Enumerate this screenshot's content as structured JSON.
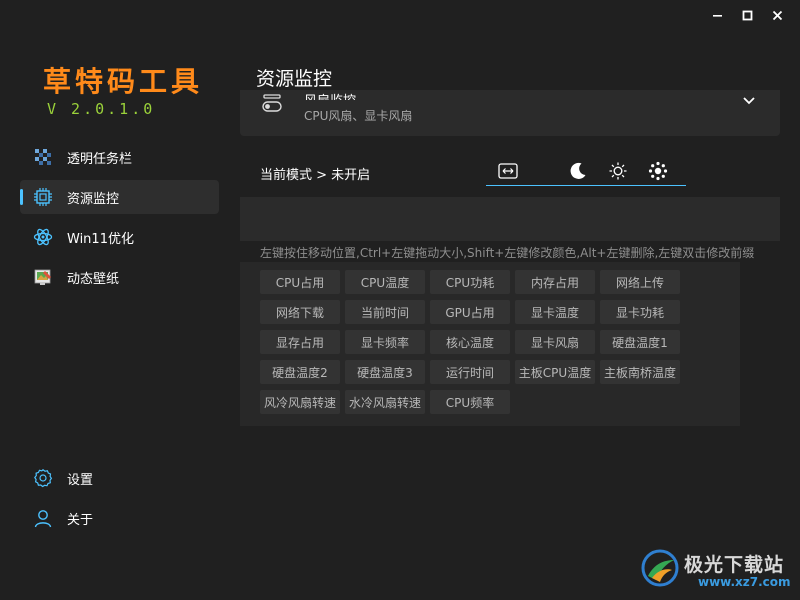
{
  "window": {
    "minimize": "—",
    "maximize": "□",
    "close": "×"
  },
  "app": {
    "title": "草特码工具",
    "version": "V 2.0.1.0"
  },
  "sidebar": {
    "items": [
      {
        "label": "透明任务栏",
        "icon": "checker-icon"
      },
      {
        "label": "资源监控",
        "icon": "cpu-chip-icon",
        "active": true
      },
      {
        "label": "Win11优化",
        "icon": "atom-icon"
      },
      {
        "label": "动态壁纸",
        "icon": "wallpaper-icon"
      }
    ],
    "bottom": [
      {
        "label": "设置",
        "icon": "gear-icon"
      },
      {
        "label": "关于",
        "icon": "user-icon"
      }
    ]
  },
  "main": {
    "title": "资源监控",
    "card": {
      "title_partial": "风扇监控",
      "subtitle": "CPU风扇、显卡风扇"
    },
    "mode": "当前模式 > 未开启",
    "toolbar": [
      "resize-horizontal-icon",
      "moon-icon",
      "sun-icon",
      "brightness-dots-icon"
    ],
    "hint": "左键按住移动位置,Ctrl+左键拖动大小,Shift+左键修改颜色,Alt+左键删除,左键双击修改前缀",
    "chips": [
      "CPU占用",
      "CPU温度",
      "CPU功耗",
      "内存占用",
      "网络上传",
      "网络下载",
      "当前时间",
      "GPU占用",
      "显卡温度",
      "显卡功耗",
      "显存占用",
      "显卡频率",
      "核心温度",
      "显卡风扇",
      "硬盘温度1",
      "硬盘温度2",
      "硬盘温度3",
      "运行时间",
      "主板CPU温度",
      "主板南桥温度",
      "风冷风扇转速",
      "水冷风扇转速",
      "CPU频率"
    ]
  },
  "watermark": {
    "text": "极光下载站",
    "url": "www.xz7.com"
  },
  "colors": {
    "accent": "#4cc2ff",
    "title": "#ff8a1a",
    "version": "#9bd23a",
    "bg": "#202020"
  }
}
